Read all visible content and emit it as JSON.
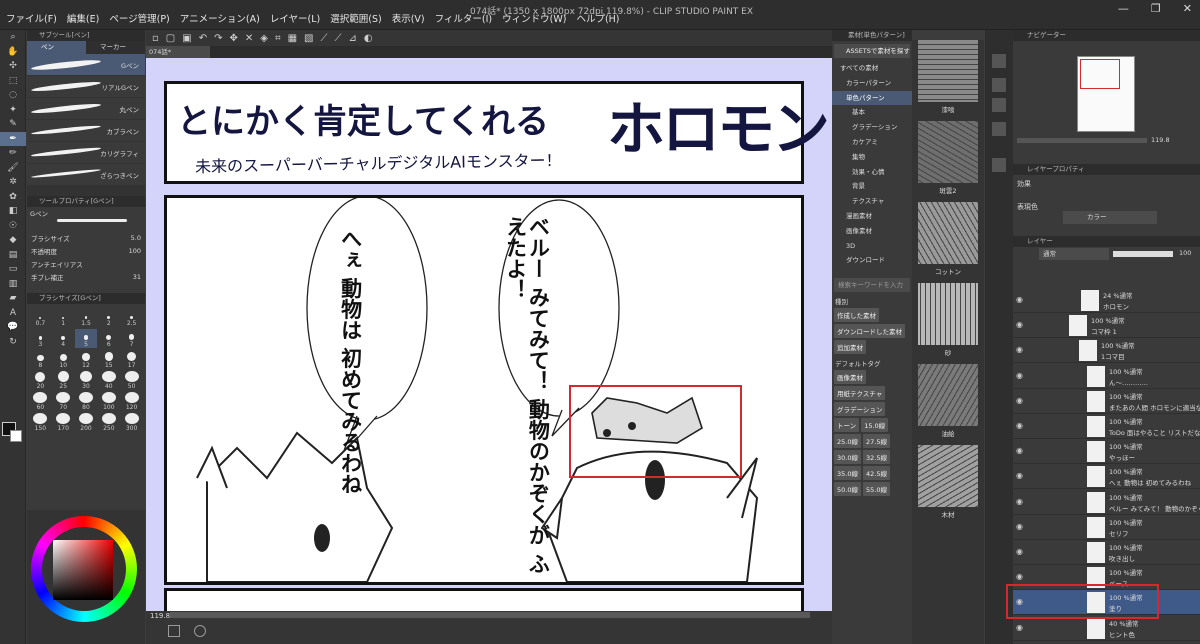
{
  "window": {
    "title": "074話* (1350 x 1800px 72dpi 119.8%) - CLIP STUDIO PAINT EX",
    "controls": [
      "—",
      "❐",
      "✕"
    ]
  },
  "menu": [
    "ファイル(F)",
    "編集(E)",
    "ページ管理(P)",
    "アニメーション(A)",
    "レイヤー(L)",
    "選択範囲(S)",
    "表示(V)",
    "フィルター(I)",
    "ウィンドウ(W)",
    "ヘルプ(H)"
  ],
  "tabs": {
    "document": "074話*"
  },
  "subtool": {
    "header": "サブツール[ペン]",
    "tab1": "ペン",
    "tab2": "マーカー",
    "brushes": [
      "Gペン",
      "リアルGペン",
      "丸ペン",
      "カブラペン",
      "カリグラフィ",
      "ざらつきペン"
    ]
  },
  "toolprop": {
    "header": "ツールプロパティ[Gペン]",
    "name": "Gペン",
    "rows": [
      {
        "label": "ブラシサイズ",
        "value": "5.0"
      },
      {
        "label": "不透明度",
        "value": "100"
      },
      {
        "label": "アンチエイリアス",
        "value": ""
      },
      {
        "label": "手ブレ補正",
        "value": "31"
      }
    ]
  },
  "brushsize": {
    "header": "ブラシサイズ[Gペン]",
    "values": [
      "0.7",
      "1",
      "1.5",
      "2",
      "2.5",
      "3",
      "4",
      "5",
      "6",
      "7",
      "8",
      "10",
      "12",
      "15",
      "17",
      "20",
      "25",
      "30",
      "40",
      "50",
      "60",
      "70",
      "80",
      "100",
      "120",
      "150",
      "170",
      "200",
      "250",
      "300"
    ],
    "selected": "5"
  },
  "status": {
    "zoom": "119.8"
  },
  "comic": {
    "title": "とにかく肯定してくれる",
    "title_big": "ホロモン",
    "subtitle": "未来のスーパーバーチャルデジタルAIモンスター！",
    "bubble1": "へぇ 動物は 初めてみるわね",
    "bubble2": "ベルー みてみて！ 動物のかぞくが ふえたよ！"
  },
  "material": {
    "header": "素材[単色パターン]",
    "assets_btn": "ASSETSで素材を探す",
    "tree": [
      "すべての素材",
      "カラーパターン",
      "単色パターン",
      "基本",
      "グラデーション",
      "カケアミ",
      "集物",
      "効果・心情",
      "背景",
      "テクスチャ",
      "漫画素材",
      "画像素材",
      "3D",
      "ダウンロード"
    ],
    "selected": "単色パターン",
    "search_placeholder": "検索キーワードを入力",
    "tag_head": "種別",
    "tags": [
      "作成した素材",
      "ダウンロードした素材",
      "追加素材"
    ],
    "tag_head2": "デフォルトタグ",
    "tags2": [
      "画像素材",
      "用紙テクスチャ",
      "グラデーション",
      "トーン",
      "15.0線",
      "25.0線",
      "27.5線",
      "30.0線",
      "32.5線",
      "35.0線",
      "42.5線",
      "50.0線",
      "55.0線"
    ],
    "thumbs": [
      "漆喰",
      "斑雲2",
      "コットン",
      "砂",
      "油絵",
      "木材"
    ]
  },
  "navigator": {
    "header": "ナビゲーター",
    "zoom": "119.8"
  },
  "layerprop": {
    "header": "レイヤープロパティ",
    "effect": "効果",
    "expr_label": "表現色",
    "expr_value": "カラー"
  },
  "layers": {
    "header": "レイヤー",
    "blend": "通常",
    "opacity": "100",
    "items": [
      {
        "mode": "24 %通常",
        "name": "ホロモン",
        "indent": 18
      },
      {
        "mode": "100 %通常",
        "name": "コマ枠 1",
        "indent": 6
      },
      {
        "mode": "100 %通常",
        "name": "1コマ目",
        "indent": 16
      },
      {
        "mode": "100 %通常",
        "name": "ん〜…………",
        "indent": 24
      },
      {
        "mode": "100 %通常",
        "name": "またあの人間 ホロモンに適当なこと教えて",
        "indent": 24
      },
      {
        "mode": "100 %通常",
        "name": "ToDo 面はやること リストだな",
        "indent": 24
      },
      {
        "mode": "100 %通常",
        "name": "やっほー",
        "indent": 24
      },
      {
        "mode": "100 %通常",
        "name": "へぇ 動物は 初めてみるわね",
        "indent": 24
      },
      {
        "mode": "100 %通常",
        "name": "ベルー みてみて！ 動物のかぞくがふえたよ",
        "indent": 24
      },
      {
        "mode": "100 %通常",
        "name": "セリフ",
        "indent": 24
      },
      {
        "mode": "100 %通常",
        "name": "吹き出し",
        "indent": 24
      },
      {
        "mode": "100 %通常",
        "name": "ベース",
        "indent": 24
      },
      {
        "mode": "100 %通常",
        "name": "塗り",
        "indent": 24
      },
      {
        "mode": "40 %通常",
        "name": "ヒント色",
        "indent": 24
      }
    ],
    "selected": "塗り"
  }
}
